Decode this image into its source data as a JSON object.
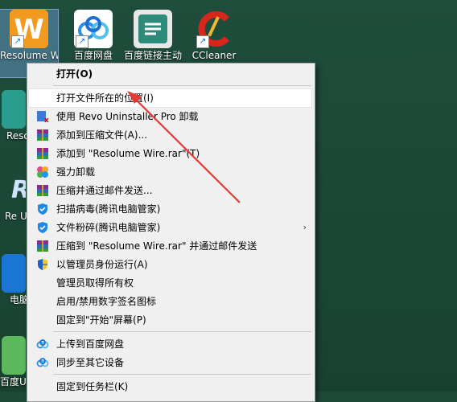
{
  "desktop": {
    "icons": [
      {
        "label": "Resolume W",
        "icon": "resolume-wire-icon"
      },
      {
        "label": "百度网盘",
        "icon": "baidu-netdisk-icon"
      },
      {
        "label": "百度链接主动",
        "icon": "baidu-link-icon"
      },
      {
        "label": "CCleaner",
        "icon": "ccleaner-icon"
      },
      {
        "label": "Reso Ar",
        "icon": "resolume-arena-icon"
      },
      {
        "label": "Re Unin",
        "icon": "revo-uninstaller-icon"
      },
      {
        "label": "电脑",
        "icon": "pc-manager-icon"
      },
      {
        "label": "百度U",
        "icon": "baidu-u-icon"
      }
    ]
  },
  "menu": {
    "items": [
      {
        "label": "打开(O)",
        "icon": "",
        "bold": true
      },
      {
        "label": "打开文件所在的位置(I)",
        "icon": ""
      },
      {
        "label": "使用 Revo Uninstaller Pro 卸载",
        "icon": "revo-icon"
      },
      {
        "label": "添加到压缩文件(A)...",
        "icon": "winrar-icon"
      },
      {
        "label": "添加到 \"Resolume Wire.rar\"(T)",
        "icon": "winrar-icon"
      },
      {
        "label": "强力卸载",
        "icon": "clover-icon"
      },
      {
        "label": "压缩并通过邮件发送...",
        "icon": "winrar-icon"
      },
      {
        "label": "扫描病毒(腾讯电脑管家)",
        "icon": "shield-icon"
      },
      {
        "label": "文件粉碎(腾讯电脑管家)",
        "icon": "shield-icon",
        "submenu": true
      },
      {
        "label": "压缩到 \"Resolume Wire.rar\" 并通过邮件发送",
        "icon": "winrar-icon"
      },
      {
        "label": "以管理员身份运行(A)",
        "icon": "uac-shield-icon"
      },
      {
        "label": "管理员取得所有权",
        "icon": ""
      },
      {
        "label": "启用/禁用数字签名图标",
        "icon": ""
      },
      {
        "label": "固定到\"开始\"屏幕(P)",
        "icon": ""
      },
      {
        "label": "上传到百度网盘",
        "icon": "baidu-cloud-icon"
      },
      {
        "label": "同步至其它设备",
        "icon": "baidu-cloud-icon"
      },
      {
        "label": "固定到任务栏(K)",
        "icon": ""
      }
    ],
    "submenu_glyph": "›"
  },
  "colors": {
    "arrow": "#e53935",
    "menu_bg": "#f0f0f0"
  }
}
